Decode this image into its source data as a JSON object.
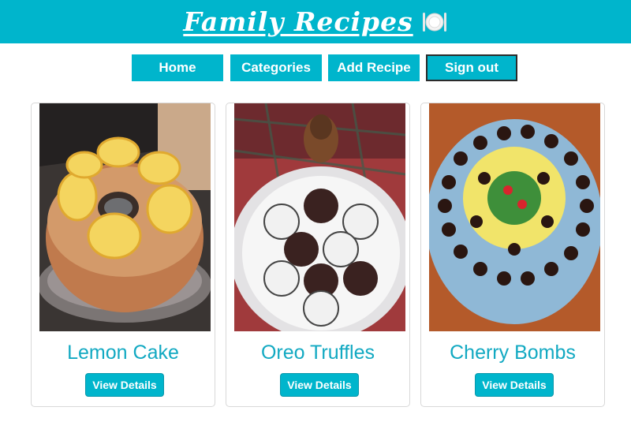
{
  "header": {
    "title": "Family Recipes",
    "icon": "plate-cutlery-icon",
    "bg_color": "#00b5cc"
  },
  "nav": {
    "items": [
      {
        "label": "Home"
      },
      {
        "label": "Categories"
      },
      {
        "label": "Add Recipe"
      },
      {
        "label": "Sign out"
      }
    ],
    "active_item": "Sign out"
  },
  "recipes": [
    {
      "title": "Lemon Cake",
      "button_label": "View Details",
      "image": "lemon-cake-photo"
    },
    {
      "title": "Oreo Truffles",
      "button_label": "View Details",
      "image": "oreo-truffles-photo"
    },
    {
      "title": "Cherry Bombs",
      "button_label": "View Details",
      "image": "cherry-bombs-photo"
    }
  ],
  "colors": {
    "accent": "#00b5cc",
    "title_text": "#12a9c2"
  }
}
